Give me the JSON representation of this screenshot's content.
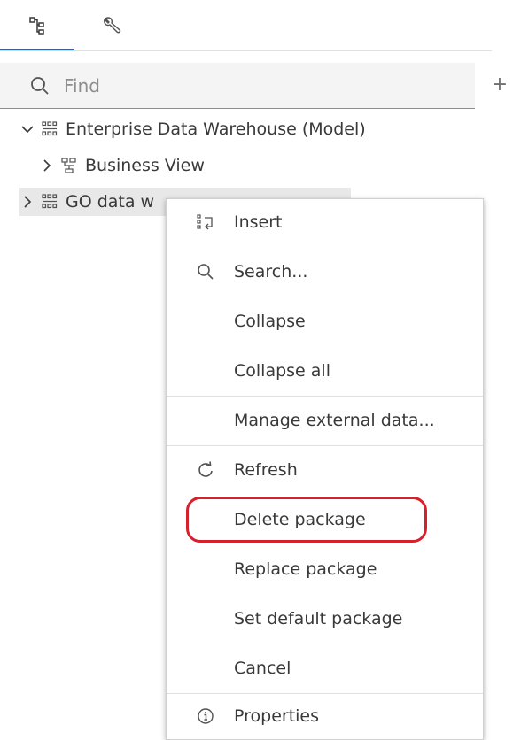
{
  "tabs": [
    {
      "icon": "tree-structure-icon",
      "active": true
    },
    {
      "icon": "wrench-icon",
      "active": false
    }
  ],
  "search": {
    "placeholder": "Find",
    "value": ""
  },
  "add_button": {
    "icon": "plus-icon",
    "label": "+"
  },
  "tree": {
    "items": [
      {
        "label": "Enterprise Data Warehouse (Model)",
        "expanded": true,
        "icon": "data-module-icon"
      },
      {
        "label": "Business View",
        "expanded": false,
        "icon": "hierarchy-icon"
      },
      {
        "label": "GO data w",
        "expanded": false,
        "icon": "data-module-icon",
        "selected": true
      }
    ]
  },
  "context_menu": {
    "items": [
      {
        "label": "Insert",
        "icon": "insert-icon"
      },
      {
        "label": "Search...",
        "icon": "search-icon"
      },
      {
        "label": "Collapse",
        "icon": ""
      },
      {
        "label": "Collapse all",
        "icon": ""
      },
      {
        "label": "Manage external data...",
        "icon": ""
      },
      {
        "label": "Refresh",
        "icon": "refresh-icon"
      },
      {
        "label": "Delete package",
        "icon": ""
      },
      {
        "label": "Replace package",
        "icon": ""
      },
      {
        "label": "Set default package",
        "icon": ""
      },
      {
        "label": "Cancel",
        "icon": ""
      },
      {
        "label": "Properties",
        "icon": "info-icon"
      }
    ]
  },
  "colors": {
    "accent": "#0f62fe",
    "annotation_ring": "#d6202b",
    "selected_row": "#e8e8e8"
  }
}
